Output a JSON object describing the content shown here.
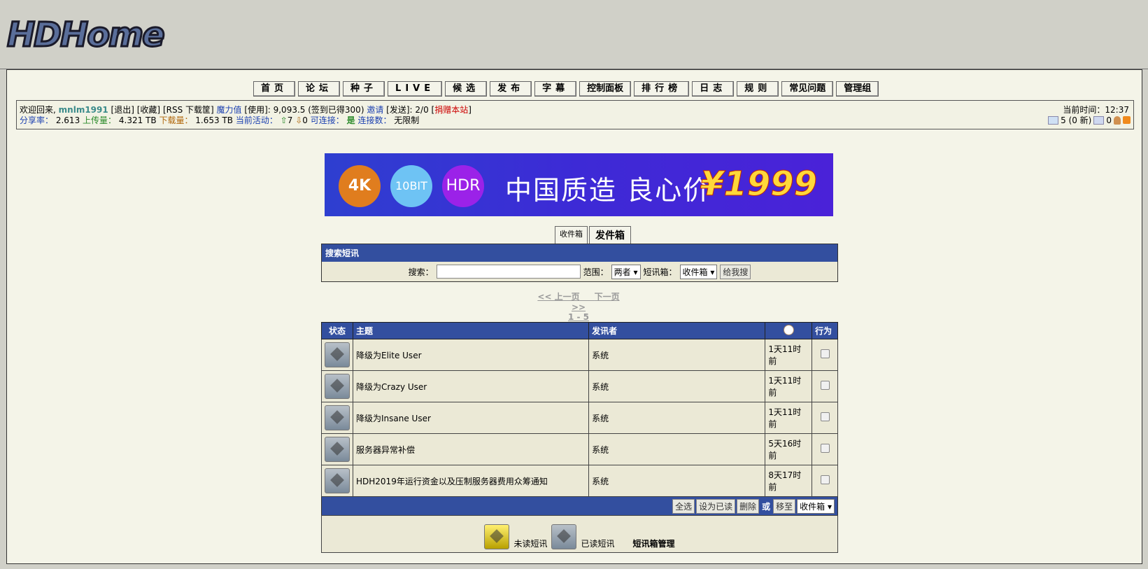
{
  "logo": {
    "text": "HDHome"
  },
  "nav": [
    "首页",
    "论坛",
    "种子",
    "LIVE",
    "候选",
    "发布",
    "字幕",
    "控制面板",
    "排行榜",
    "日志",
    "规则",
    "常见问题",
    "管理组"
  ],
  "user": {
    "welcome": "欢迎回来,",
    "username": "mnlm1991",
    "logout": "[退出]",
    "bookmarks": "[收藏]",
    "rss": "[RSS 下载筐]",
    "bonus_label": "魔力值",
    "bonus_text": "[使用]: 9,093.5 (签到已得300)",
    "invite_label": "邀请",
    "invite_text": "[发送]: 2/0",
    "donate": "捐赠本站",
    "ratio_label": "分享率：",
    "ratio": "2.613",
    "upload_label": "上传量：",
    "upload": "4.321 TB",
    "download_label": "下载量：",
    "download": "1.653 TB",
    "active_label": "当前活动：",
    "seeding": "7",
    "leeching": "0",
    "connectable_label": "可连接：",
    "connectable": "是",
    "connections_label": "连接数：",
    "connections": "无限制",
    "time_label": "当前时间：12:37",
    "messages_text": "5 (0 新)",
    "friends_count": "0"
  },
  "banner": {
    "c1": "4K",
    "c2": "10BIT",
    "c3": "HDR",
    "slogan": "中国质造 良心价",
    "price": "¥1999",
    "colors": {
      "c1": "#e07d1e",
      "c2": "#6ec3f4",
      "c3": "#9b22e8"
    }
  },
  "boxtabs": {
    "inbox": "收件箱",
    "outbox": "发件箱"
  },
  "search": {
    "title": "搜索短讯",
    "label": "搜索：",
    "value": "",
    "scope_label": "范围：",
    "scope": "两者 ▾",
    "box_label": "短讯箱：",
    "box": "收件箱 ▾",
    "submit": "给我搜"
  },
  "pager": {
    "prev": "<< 上一页",
    "next": "下一页 >>",
    "range": "1 - 5"
  },
  "table": {
    "headers": {
      "status": "状态",
      "subject": "主题",
      "sender": "发讯者",
      "action": "行为"
    },
    "rows": [
      {
        "subject": "降级为Elite User",
        "sender": "系统",
        "time": "1天11时前"
      },
      {
        "subject": "降级为Crazy User",
        "sender": "系统",
        "time": "1天11时前"
      },
      {
        "subject": "降级为Insane User",
        "sender": "系统",
        "time": "1天11时前"
      },
      {
        "subject": "服务器异常补偿",
        "sender": "系统",
        "time": "5天16时前"
      },
      {
        "subject": "HDH2019年运行资金以及压制服务器费用众筹通知",
        "sender": "系统",
        "time": "8天17时前"
      }
    ]
  },
  "actions": {
    "select_all": "全选",
    "mark_read": "设为已读",
    "delete": "删除",
    "or": "或",
    "move": "移至",
    "target": "收件箱 ▾"
  },
  "legend": {
    "unread": "未读短讯",
    "read": "已读短讯",
    "manage": "短讯箱管理"
  }
}
